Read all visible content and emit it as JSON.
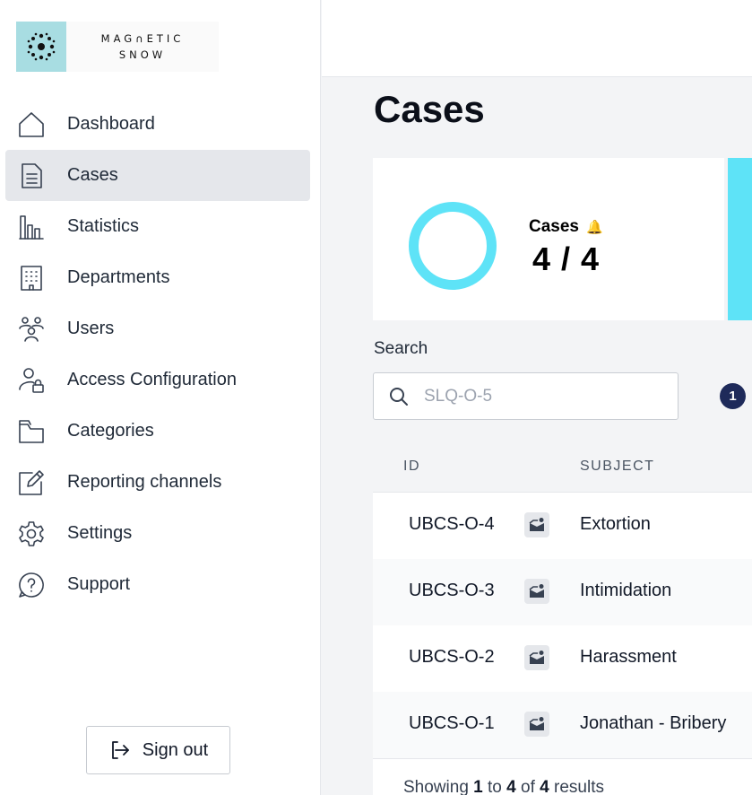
{
  "logo": {
    "line1": "MAG∩ETIC",
    "line2": "SNOW"
  },
  "sidebar": {
    "items": [
      {
        "label": "Dashboard",
        "icon": "home-icon"
      },
      {
        "label": "Cases",
        "icon": "document-icon",
        "active": true
      },
      {
        "label": "Statistics",
        "icon": "bar-chart-icon"
      },
      {
        "label": "Departments",
        "icon": "building-icon"
      },
      {
        "label": "Users",
        "icon": "users-icon"
      },
      {
        "label": "Access Configuration",
        "icon": "user-lock-icon"
      },
      {
        "label": "Categories",
        "icon": "folder-icon"
      },
      {
        "label": "Reporting channels",
        "icon": "edit-icon"
      },
      {
        "label": "Settings",
        "icon": "gear-icon"
      },
      {
        "label": "Support",
        "icon": "help-icon"
      }
    ],
    "signout_label": "Sign out"
  },
  "main": {
    "title": "Cases",
    "stat": {
      "label": "Cases",
      "value": "4 / 4",
      "accent": "#5ee3f7"
    },
    "search": {
      "label": "Search",
      "placeholder": "SLQ-O-5"
    },
    "filter_count": "1",
    "table": {
      "headers": {
        "id": "ID",
        "subject": "SUBJECT"
      },
      "rows": [
        {
          "id": "UBCS-O-4",
          "subject": "Extortion",
          "icon": "inbox-icon"
        },
        {
          "id": "UBCS-O-3",
          "subject": "Intimidation",
          "icon": "inbox-icon"
        },
        {
          "id": "UBCS-O-2",
          "subject": "Harassment",
          "icon": "inbox-icon"
        },
        {
          "id": "UBCS-O-1",
          "subject": "Jonathan - Bribery",
          "icon": "inbox-icon"
        }
      ],
      "footer": {
        "prefix": "Showing",
        "from": "1",
        "to_word": "to",
        "to": "4",
        "of_word": "of",
        "total": "4",
        "suffix": "results"
      }
    }
  }
}
